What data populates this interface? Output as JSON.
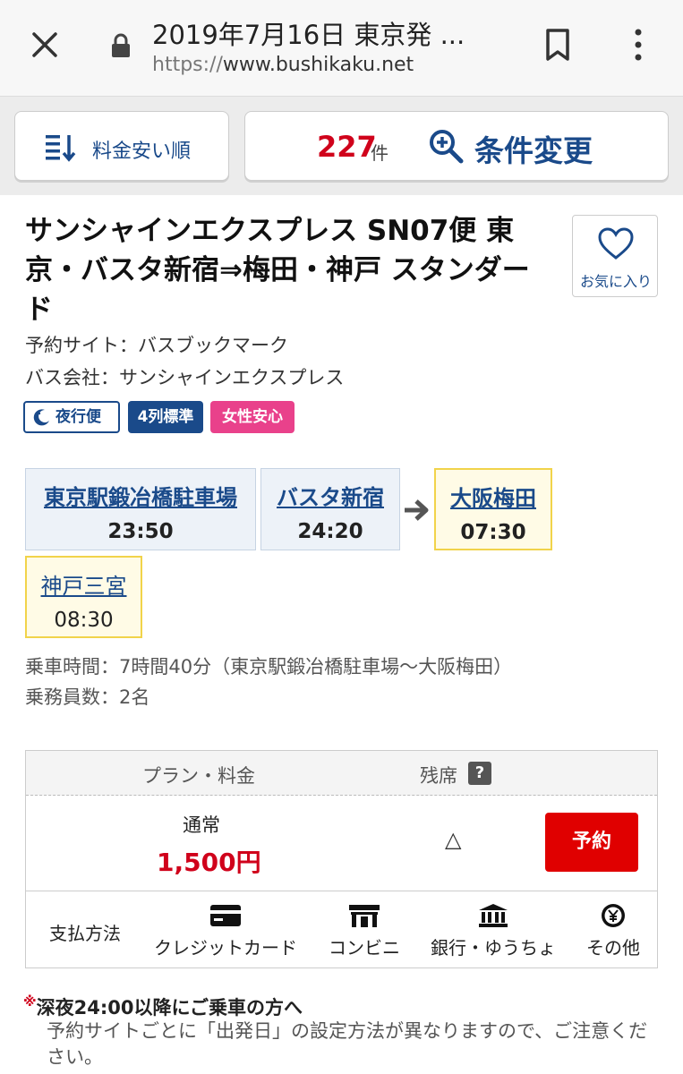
{
  "browser": {
    "title": "2019年7月16日 東京発 ...",
    "url_scheme": "https://",
    "url_host": "www.bushikaku.net"
  },
  "toolbar": {
    "sort_label": "料金安い順",
    "result_count": "227",
    "result_unit": "件",
    "condition_label": "条件変更"
  },
  "bus": {
    "title": "サンシャインエクスプレス SN07便 東京・バスタ新宿⇒梅田・神戸 スタンダード",
    "favorite_label": "お気に入り",
    "booking_site": "予約サイト：バスブックマーク",
    "company": "バス会社：サンシャインエクスプレス",
    "badges": {
      "night": "夜行便",
      "seats": "4列標準",
      "women": "女性安心"
    },
    "stops": [
      {
        "name": "東京駅鍛冶橋駐車場",
        "time": "23:50"
      },
      {
        "name": "バスタ新宿",
        "time": "24:20"
      },
      {
        "name": "大阪梅田",
        "time": "07:30"
      },
      {
        "name": "神戸三宮",
        "time": "08:30"
      }
    ],
    "ride_time": "乗車時間：7時間40分（東京駅鍛冶橋駐車場〜大阪梅田）",
    "crew": "乗務員数：2名"
  },
  "plan_table": {
    "header_plan": "プラン・料金",
    "header_seat": "残席",
    "help": "?",
    "plan_name": "通常",
    "price": "1,500円",
    "seat_status": "△",
    "reserve_label": "予約",
    "pay_label": "支払方法",
    "pay_methods": [
      {
        "icon": "credit-card-icon",
        "label": "クレジットカード"
      },
      {
        "icon": "convenience-store-icon",
        "label": "コンビニ"
      },
      {
        "icon": "bank-icon",
        "label": "銀行・ゆうちょ"
      },
      {
        "icon": "yen-coin-icon",
        "label": "その他"
      }
    ]
  },
  "notice": {
    "mark": "※",
    "title": "深夜24:00以降にご乗車の方へ",
    "body": "予約サイトごとに「出発日」の設定方法が異なりますので、ご注意ください。"
  },
  "colors": {
    "brand_blue": "#1a4a8a",
    "price_red": "#d0021b",
    "reserve_red": "#e00000",
    "women_pink": "#e9418b",
    "destination_yellow": "#f1d34a"
  }
}
